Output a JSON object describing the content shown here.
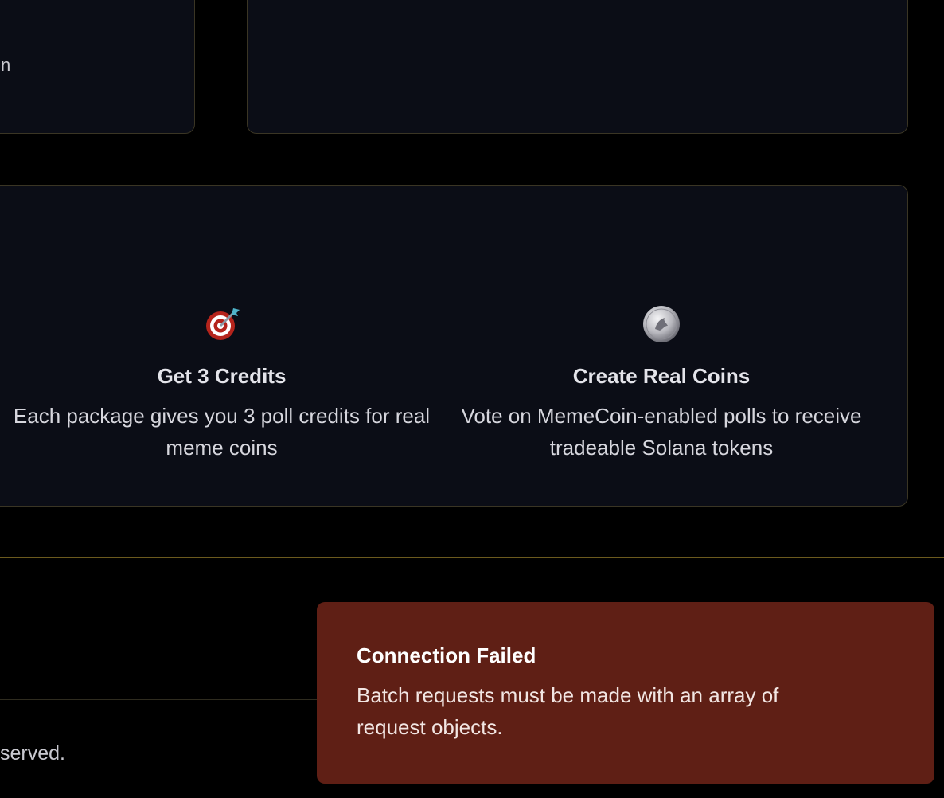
{
  "top_left_card": {
    "text_fragment": "n"
  },
  "features": [
    {
      "icon": "dart-target-icon",
      "title": "Get 3 Credits",
      "description": "Each package gives you 3 poll credits for real meme coins"
    },
    {
      "icon": "coin-icon",
      "title": "Create Real Coins",
      "description": "Vote on MemeCoin-enabled polls to receive tradeable Solana tokens"
    }
  ],
  "footer": {
    "rights_text": "served."
  },
  "toast": {
    "title": "Connection Failed",
    "message": "Batch requests must be made with an array of request objects."
  },
  "colors": {
    "background": "#000000",
    "card_bg": "#0b0d16",
    "card_border": "#3a3524",
    "accent_gold": "#6b5a1e",
    "toast_bg": "#5f1f15"
  }
}
